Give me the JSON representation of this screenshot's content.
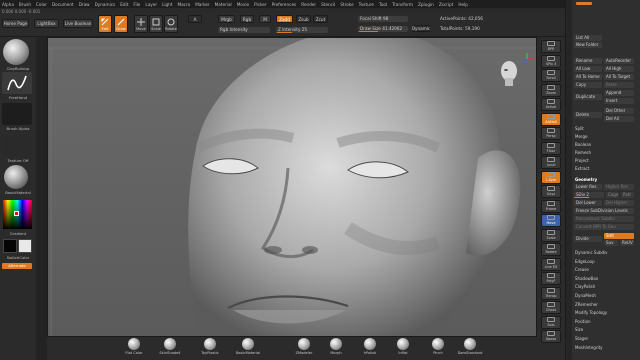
{
  "menu": [
    "Alpha",
    "Brush",
    "Color",
    "Document",
    "Draw",
    "Dynamics",
    "Edit",
    "File",
    "Layer",
    "Light",
    "Macro",
    "Marker",
    "Material",
    "Movie",
    "Picker",
    "Preferences",
    "Render",
    "Stencil",
    "Stroke",
    "Texture",
    "Tool",
    "Transform",
    "Zplugin",
    "Zscript",
    "Help"
  ],
  "coords": "0.000  0.000  -0.001",
  "toolbar": {
    "home_page": "Home Page",
    "lightbox": "LightBox",
    "live_boolean": "Live Boolean",
    "tools": [
      "Edit",
      "Draw",
      "Move",
      "Scale",
      "Rotate"
    ],
    "a_label": "A",
    "mrgb": "Mrgb",
    "rgb": "Rgb",
    "m": "M",
    "rgb_intensity": "Rgb Intensity",
    "zadd": "Zadd",
    "zsub": "Zsub",
    "zcut": "Zcut",
    "z_intensity": "Z Intensity 25",
    "focal_shift": "Focal Shift 98",
    "draw_size": "Draw Size 41.42062",
    "dynamic": "Dynamic",
    "active_points": "ActivePoints: 42,056",
    "total_points": "TotalPoints: 59,190"
  },
  "leftshelf": {
    "brush_label": "ClayBuildup",
    "stroke_label": "FreeHand",
    "alpha_label": "Brush Alpha",
    "texture_label": "Texture Off",
    "material_label": "BasicMaterial",
    "gradient_label": "Gradient",
    "switch_label": "SwitchColor",
    "alternate_label": "Alternate"
  },
  "rightshelf": [
    "BPR",
    "SPix 3",
    "Scroll",
    "Zoom",
    "Actual",
    "AAHalf",
    "Persp",
    "Floor",
    "Local",
    "L.Sym",
    "Gxyz",
    "Frame",
    "Move",
    "Scale",
    "Rotate",
    "Line Fill",
    "PolyF",
    "Transp",
    "Ghost",
    "Solo",
    "Xpose"
  ],
  "palette": {
    "list_all": "List All",
    "new_folder": "New Folder",
    "rename": "Rename",
    "autoreorder": "AutoReorder",
    "all_low": "All Low",
    "all_high": "All High",
    "all_to_home": "All To Home",
    "all_to_target": "All To Target",
    "copy": "Copy",
    "paste": "Paste",
    "duplicate": "Duplicate",
    "append": "Append",
    "insert": "Insert",
    "delete": "Delete",
    "del_other": "Del Other",
    "del_all": "Del All",
    "split": "Split",
    "merge": "Merge",
    "boolean": "Boolean",
    "remesh": "Remesh",
    "project": "Project",
    "extract": "Extract",
    "geometry": "Geometry",
    "lower_res": "Lower Res",
    "higher_res": "Higher Res",
    "sdiv": "SDiv 2",
    "cage": "Cage",
    "rstr": "Rstr",
    "del_lower": "Del Lower",
    "del_higher": "Del Higher",
    "freeze": "Freeze SubDivision Levels",
    "reconstruct": "Reconstruct Subdiv",
    "convert_bpr": "Convert BPR To Geo",
    "divide": "Divide",
    "smt": "Smt",
    "suv": "Suv",
    "reuv": "ReUV",
    "list": [
      "Dynamic Subdiv",
      "EdgeLoop",
      "Crease",
      "ShadowBox",
      "ClayPolish",
      "DynaMesh",
      "ZRemesher",
      "Modify Topology",
      "Position",
      "Size",
      "Stager",
      "MeshIntegrity"
    ]
  },
  "bottomshelf": [
    "Flat Color",
    "SkinShade4",
    "ToyPlastic",
    "BasicMaterial",
    "ZModeler",
    "Morph",
    "hPolish",
    "Inflat",
    "Pinch",
    "DamStandard"
  ]
}
